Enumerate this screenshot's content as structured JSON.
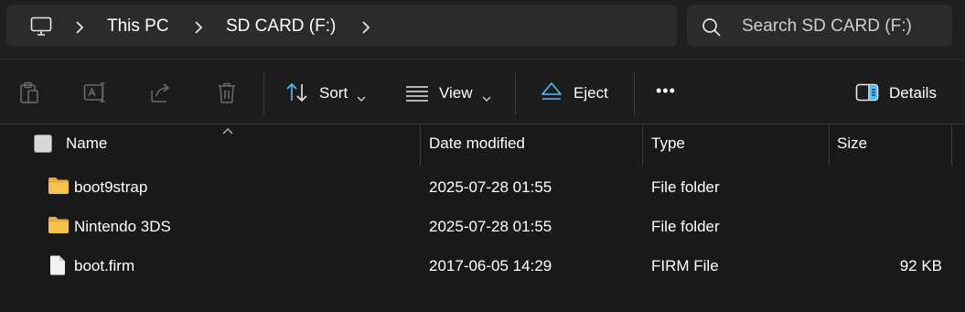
{
  "address_bar": {
    "breadcrumbs": [
      "This PC",
      "SD CARD (F:)"
    ]
  },
  "search": {
    "placeholder": "Search SD CARD (F:)"
  },
  "toolbar": {
    "sort_label": "Sort",
    "view_label": "View",
    "eject_label": "Eject",
    "more_label": "•••",
    "details_label": "Details"
  },
  "columns": {
    "name": "Name",
    "date_modified": "Date modified",
    "type": "Type",
    "size": "Size"
  },
  "files": [
    {
      "name": "boot9strap",
      "date": "2025-07-28 01:55",
      "type": "File folder",
      "size": "",
      "icon": "folder-icon"
    },
    {
      "name": "Nintendo 3DS",
      "date": "2025-07-28 01:55",
      "type": "File folder",
      "size": "",
      "icon": "folder-icon"
    },
    {
      "name": "boot.firm",
      "date": "2017-06-05 14:29",
      "type": "FIRM File",
      "size": "92 KB",
      "icon": "file-icon"
    }
  ],
  "colors": {
    "background": "#191919",
    "accent": "#4cc2ff",
    "folder": "#f4c44e"
  }
}
